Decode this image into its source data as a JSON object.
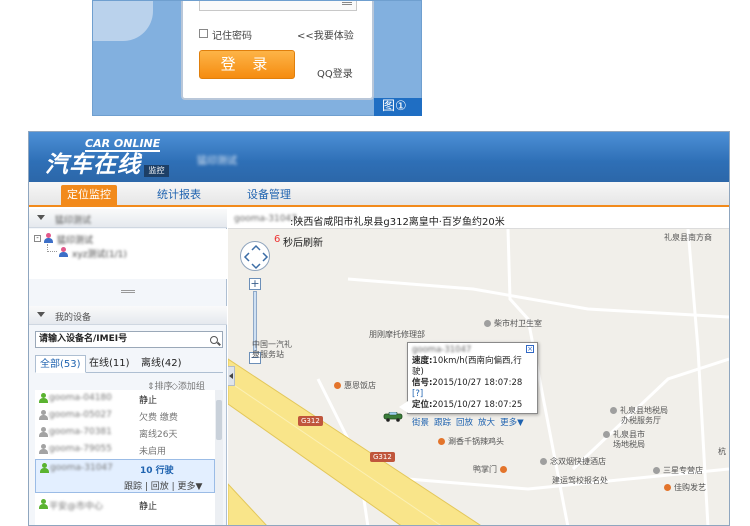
{
  "login": {
    "remember_label": "记住密码",
    "trial_link": "<<我要体验",
    "login_button": "登 录",
    "qq_link": "QQ登录",
    "figure_label": "图①"
  },
  "app": {
    "logo_en": "CAR ONLINE",
    "logo_cn": "汽车在线",
    "logo_tag": "监控",
    "user": "猛印测试",
    "tabs": [
      "定位监控",
      "统计报表",
      "设备管理"
    ]
  },
  "group_panel": {
    "title": "猛印测试",
    "tree_root": "猛印测试",
    "tree_child": "xyz测试(1/1)"
  },
  "device_panel": {
    "title": "我的设备",
    "search_placeholder": "请输入设备名/IMEI号",
    "filters": [
      "全部(53)",
      "在线(11)",
      "离线(42)"
    ],
    "sort": "⇕排序",
    "add_group": "◇添加组",
    "devices": [
      {
        "name": "gooma-04180",
        "status": "静止",
        "online": true
      },
      {
        "name": "gooma-05027",
        "status": "欠费 缴费",
        "online": false
      },
      {
        "name": "gooma-70381",
        "status": "离线26天",
        "online": false
      },
      {
        "name": "gooma-79055",
        "status": "未启用",
        "online": false
      },
      {
        "name": "gooma-31047",
        "status": "10 行驶",
        "online": true,
        "selected": true,
        "actions": "跟踪 | 回放 | 更多▼"
      },
      {
        "name": "平安@市中心",
        "status": "静止",
        "online": true
      }
    ]
  },
  "map": {
    "addr_device": "gooma-31047",
    "address": ":陕西省咸阳市礼泉县g312离皇中·百岁鱼约20米",
    "refresh_seconds": "6",
    "refresh_text": "秒后刷新",
    "pois": [
      "礼泉县南方商",
      "柴市村卫生室",
      "朋刚摩托修理部",
      "中国一汽礼",
      "泉服务站",
      "惠恩饭店",
      "礼泉县地税局",
      "办税服务厅",
      "礼泉县市",
      "场地税局",
      "涮香千锅辣鸡头",
      "念双烟快捷酒店",
      "鸭掌门",
      "三星专营店",
      "建运驾校报名处",
      "佳购发艺",
      "杭"
    ],
    "road_labels": [
      "G312",
      "G312"
    ],
    "popup": {
      "title": "gooma-31047",
      "speed_label": "速度:",
      "speed_value": "10km/h(西南向偏西,行驶)",
      "signal_label": "信号:",
      "signal_value": "2015/10/27 18:07:28 ",
      "signal_link": "[?]",
      "locate_label": "定位:",
      "locate_value": "2015/10/27 18:07:25",
      "links": [
        "街景",
        "跟踪",
        "回放",
        "放大",
        "更多▼"
      ]
    }
  },
  "colors": {
    "accent_orange": "#f28a1b",
    "header_blue": "#2e6fb6",
    "link_blue": "#1f63b0",
    "online_green": "#5ab330",
    "offline_gray": "#a3a3a3"
  }
}
